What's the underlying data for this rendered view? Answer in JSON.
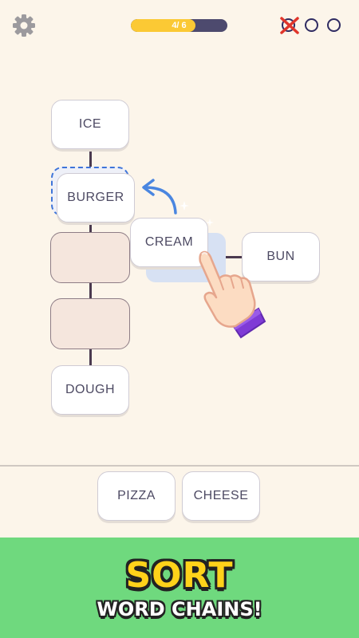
{
  "header": {
    "progress_label": "4/ 6",
    "progress_fraction": 0.667,
    "settings_icon": "gear-icon",
    "lives": {
      "total": 3,
      "lost": 1
    }
  },
  "board": {
    "chain_words": [
      "ICE",
      "BURGER",
      "DOUGH"
    ],
    "dragged_word": "CREAM",
    "side_word": "BUN",
    "empty_slots": 2
  },
  "tray": {
    "words": [
      "PIZZA",
      "CHEESE"
    ]
  },
  "banner": {
    "title": "SORT",
    "subtitle": "WORD CHAINS!"
  },
  "colors": {
    "background": "#fcf5ea",
    "progress_fill": "#fbc934",
    "progress_track": "#4d4a6e",
    "lost_life": "#e0352b",
    "banner_bg": "#6fd97e",
    "banner_title": "#ffd21a"
  }
}
